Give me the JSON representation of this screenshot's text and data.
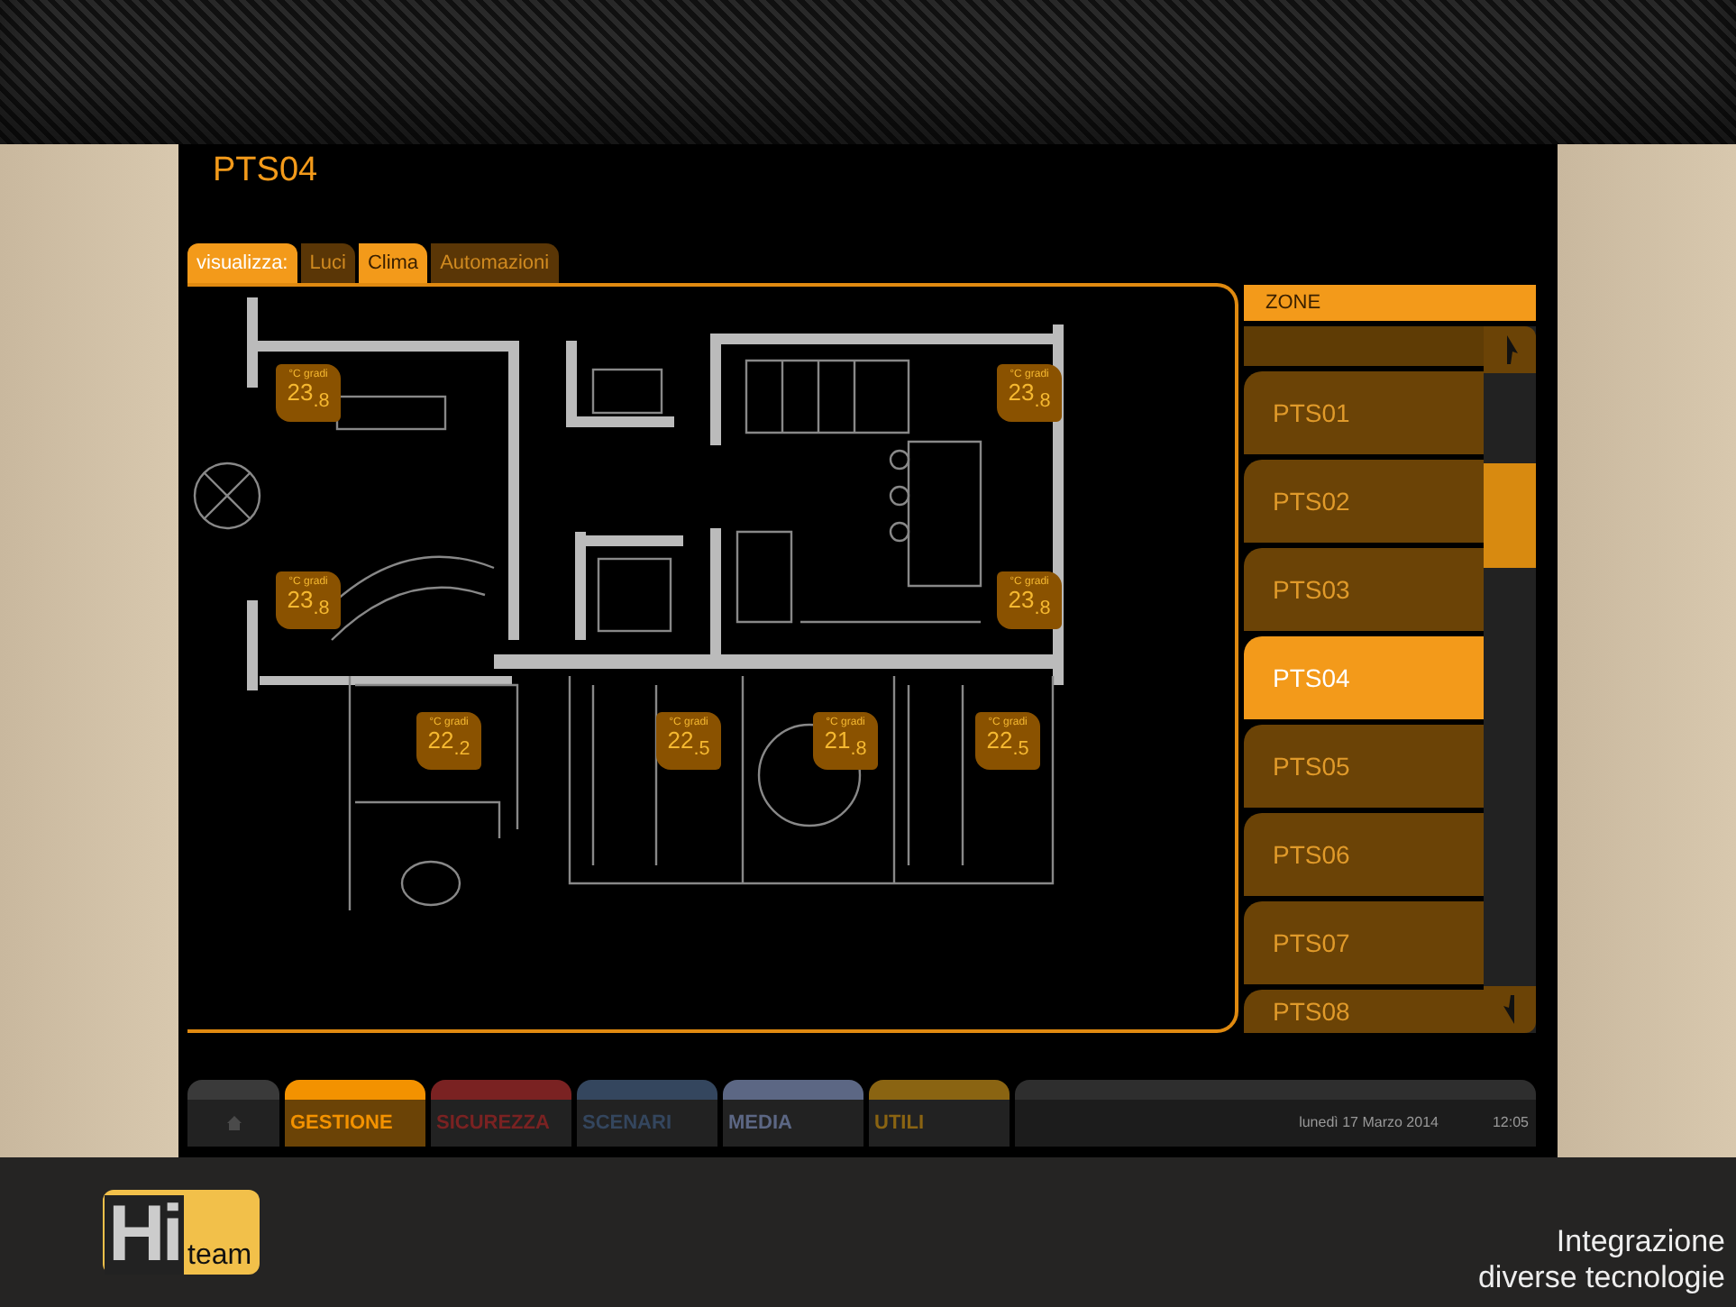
{
  "title": "PTS04",
  "view_tabs": {
    "label": "visualizza:",
    "tabs": [
      {
        "label": "Luci",
        "selected": false
      },
      {
        "label": "Clima",
        "selected": true
      },
      {
        "label": "Automazioni",
        "selected": false
      }
    ]
  },
  "sensors": [
    {
      "unit": "°C gradi",
      "value": "23$_{.8}$"
    },
    {
      "unit": "°C gradi",
      "value": "23$_{.8}$"
    },
    {
      "unit": "°C gradi",
      "value": "23$_{.8}$"
    },
    {
      "unit": "°C gradi",
      "value": "23$_{.8}$"
    },
    {
      "unit": "°C gradi",
      "value": "22$_{.2}$"
    },
    {
      "unit": "°C gradi",
      "value": "22$_{.5}$"
    },
    {
      "unit": "°C gradi",
      "value": "21$_{.8}$"
    },
    {
      "unit": "°C gradi",
      "value": "22$_{.5}$"
    }
  ],
  "zones": {
    "header": "ZONE",
    "items": [
      {
        "label": "PTS01",
        "selected": false
      },
      {
        "label": "PTS02",
        "selected": false
      },
      {
        "label": "PTS03",
        "selected": false
      },
      {
        "label": "PTS04",
        "selected": true
      },
      {
        "label": "PTS05",
        "selected": false
      },
      {
        "label": "PTS06",
        "selected": false
      },
      {
        "label": "PTS07",
        "selected": false
      },
      {
        "label": "PTS08",
        "selected": false
      }
    ]
  },
  "nav_tabs": [
    {
      "label": "GESTIONE",
      "color": "#f39200",
      "selected": true
    },
    {
      "label": "SICUREZZA",
      "color": "#7a2222",
      "selected": false
    },
    {
      "label": "SCENARI",
      "color": "#34465e",
      "selected": false
    },
    {
      "label": "MEDIA",
      "color": "#5c6784",
      "selected": false
    },
    {
      "label": "UTILI",
      "color": "#8a6412",
      "selected": false
    }
  ],
  "status": {
    "date": "lunedì 17 Marzo 2014",
    "time": "12:05"
  },
  "logo": {
    "big": "Hi",
    "small": "team"
  },
  "caption": [
    "Integrazione",
    "diverse tecnologie"
  ]
}
